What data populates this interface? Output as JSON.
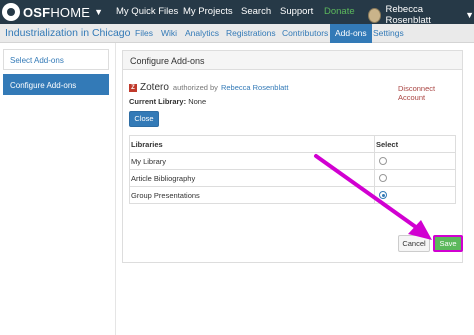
{
  "navbar": {
    "brand_prefix": "OSF",
    "brand_suffix": "HOME",
    "links": [
      "My Quick Files",
      "My Projects",
      "Search",
      "Support",
      "Donate"
    ],
    "user_name": "Rebecca Rosenblatt"
  },
  "project": {
    "title": "Industrialization in Chicago",
    "tabs": [
      "Files",
      "Wiki",
      "Analytics",
      "Registrations",
      "Contributors",
      "Add-ons",
      "Settings"
    ],
    "active_tab": "Add-ons"
  },
  "sidebar": {
    "items": [
      "Select Add-ons",
      "Configure Add-ons"
    ],
    "active": "Configure Add-ons"
  },
  "panel": {
    "heading": "Configure Add-ons",
    "addon_name": "Zotero",
    "addon_icon_letter": "Z",
    "authorized_text": "authorized by",
    "account_name": "Rebecca Rosenblatt",
    "disconnect_label": "Disconnect Account",
    "current_library_label": "Current Library:",
    "current_library_value": "None",
    "close_label": "Close",
    "table": {
      "headers": [
        "Libraries",
        "Select"
      ],
      "rows": [
        {
          "name": "My Library",
          "selected": false
        },
        {
          "name": "Article Bibliography",
          "selected": false
        },
        {
          "name": "Group Presentations",
          "selected": true
        }
      ]
    },
    "cancel_label": "Cancel",
    "save_label": "Save"
  },
  "colors": {
    "navbar_bg": "#263947",
    "accent": "#337ab7",
    "save_green": "#5cb85c",
    "annotation_magenta": "#d100d1"
  }
}
